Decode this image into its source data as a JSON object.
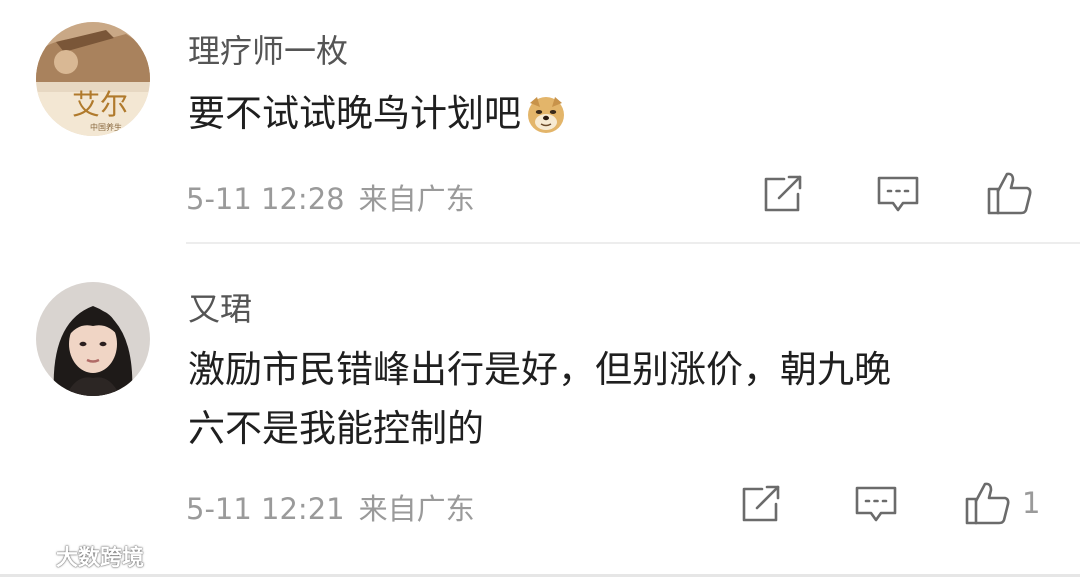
{
  "comments": [
    {
      "username": "理疗师一枚",
      "text": "要不试试晚鸟计划吧",
      "emoji": "doge-emoji",
      "avatar_text": "艾尔",
      "avatar_caption": "中国养生",
      "date": "5-11 12:28",
      "location": "来自广东",
      "like_count": ""
    },
    {
      "username": "又珺",
      "text_line1": "激励市民错峰出行是好，但别涨价，朝九晚",
      "text_line2": "六不是我能控制的",
      "date": "5-11 12:21",
      "location": "来自广东",
      "like_count": "1"
    }
  ],
  "icons": {
    "share": "share-icon",
    "reply": "comment-icon",
    "like": "thumbs-up-icon"
  },
  "watermark": {
    "text": "大数跨境"
  },
  "colors": {
    "username": "#555555",
    "text": "#1f1f1f",
    "meta": "#9a9a9a",
    "icon": "#6b6b6b",
    "divider": "#ededed"
  }
}
